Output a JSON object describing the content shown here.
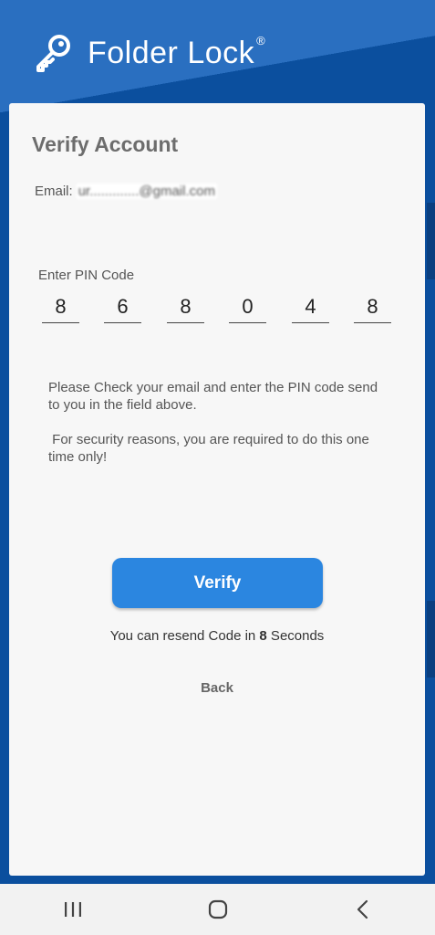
{
  "app": {
    "title": "Folder Lock",
    "reg_mark": "®"
  },
  "card": {
    "title": "Verify Account",
    "email_label": "Email:",
    "email_value": "ur.............@gmail.com",
    "pin_label": "Enter PIN Code",
    "pin_digits": [
      "8",
      "6",
      "8",
      "0",
      "4",
      "8"
    ],
    "info_1": "Please Check your email and enter the PIN code send to you in the field above.",
    "info_2": " For security reasons, you are required to do this one time only!",
    "verify_label": "Verify",
    "resend_prefix": "You can resend Code in ",
    "resend_seconds": "8",
    "resend_suffix": " Seconds",
    "back_label": "Back"
  },
  "nav": {
    "icons": [
      "recent-apps-icon",
      "home-icon",
      "back-icon"
    ]
  },
  "colors": {
    "background": "#0b4f9e",
    "accent": "#2b86e0",
    "card": "#f7f7f7"
  }
}
